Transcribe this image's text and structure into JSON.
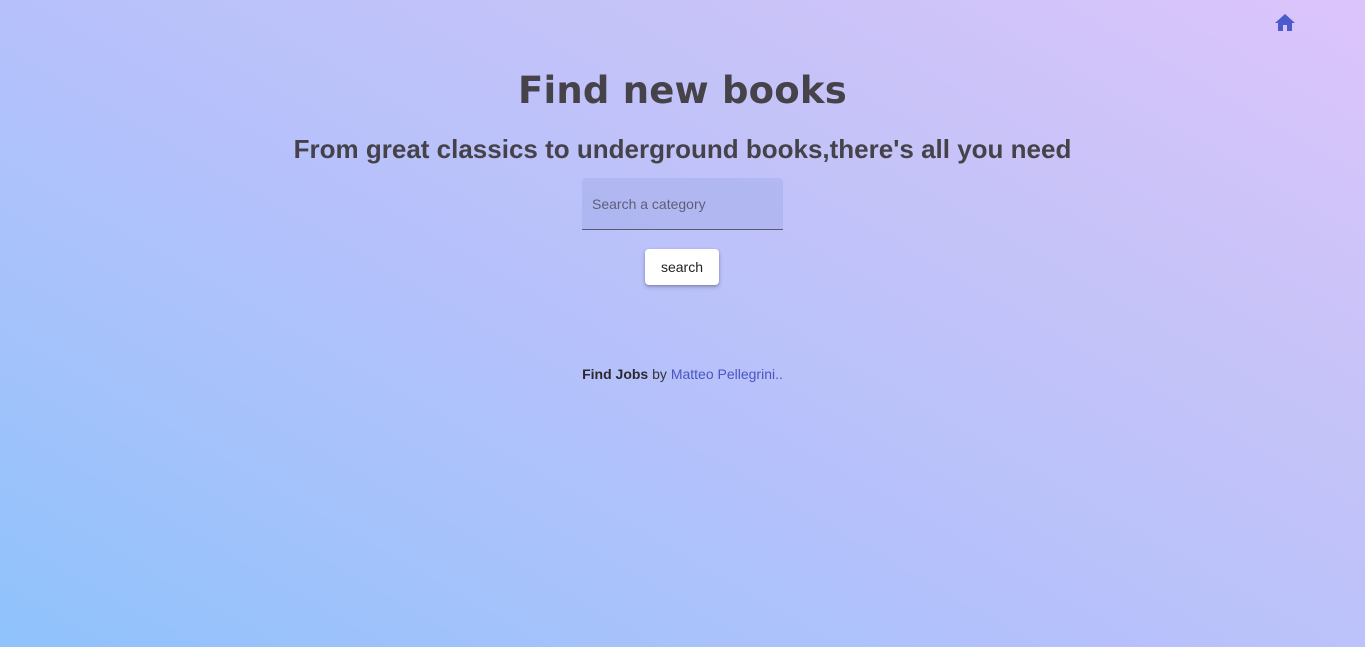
{
  "nav": {
    "home_icon": "home-icon",
    "home_color": "#4b5bcc"
  },
  "hero": {
    "title": "Find new books",
    "subtitle": "From great classics to underground books,there's all you need"
  },
  "search": {
    "placeholder": "Search a category",
    "value": "",
    "button_label": "search"
  },
  "footer": {
    "brand": "Find Jobs",
    "by": "by",
    "author": "Matteo Pellegrini.."
  }
}
